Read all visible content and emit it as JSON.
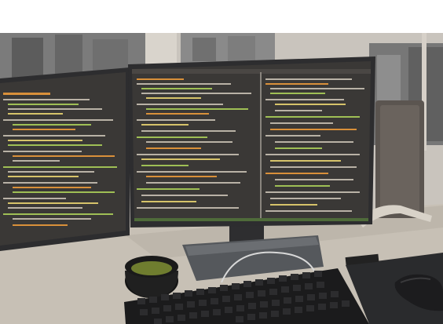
{
  "scene": {
    "description_free": true,
    "colors": {
      "top_band": "#ffffff",
      "window_sky": "#c9c4bd",
      "city_dark": "#6d6d6d",
      "city_mid": "#8f8f8d",
      "desk": "#c7c0b5",
      "desk_shadow": "#a9a299",
      "monitor_bezel": "#2d2d2f",
      "screen_bg": "#3a3836",
      "code_orange": "#d9903a",
      "code_green": "#9fbf55",
      "code_grey": "#b9b2a6",
      "code_yellow": "#d6c36a",
      "mug": "#202020",
      "tea": "#6f7d2f",
      "keyboard": "#1b1b1c",
      "mousepad": "#2a2b2d",
      "speaker": "#5b5550",
      "speaker_stand": "#d8d2c8"
    },
    "icons": [
      "monitor-left-icon",
      "monitor-center-icon",
      "mug-icon",
      "keyboard-icon",
      "mouse-icon",
      "speaker-icon"
    ]
  }
}
